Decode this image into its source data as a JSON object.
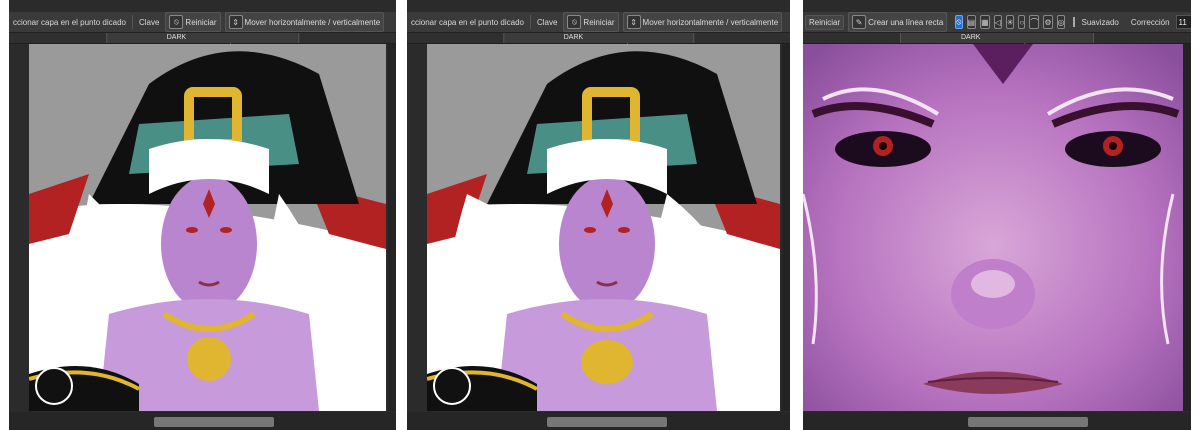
{
  "panels": [
    {
      "toolbar": {
        "select_label": "ccionar capa en el punto dicado",
        "key_label": "Clave",
        "reset_label": "Reiniciar",
        "move_label": "Mover horizontalmente / verticalmente"
      },
      "tab_title": "DARK ENCHANTRESS.mdp"
    },
    {
      "toolbar": {
        "select_label": "ccionar capa en el punto dicado",
        "key_label": "Clave",
        "reset_label": "Reiniciar",
        "move_label": "Mover horizontalmente / verticalmente"
      },
      "tab_title": "DARK ENCHANTRESS.mdp"
    },
    {
      "toolbar": {
        "reset_label": "Reiniciar",
        "line_label": "Crear una línea recta",
        "smooth_label": "Suavizado",
        "correction_label": "Corrección",
        "correction_value": "11"
      },
      "tab_title": "DARK ENCHANTRESS.mdp"
    }
  ],
  "colors": {
    "ui_dark": "#2b2b2b",
    "canvas_gray": "#9a9a9a",
    "skin": "#b985cf",
    "hat": "#101010",
    "hat_band": "#4a8f86",
    "gold": "#e0b52f",
    "red": "#b22222",
    "hair": "#ffffff"
  }
}
